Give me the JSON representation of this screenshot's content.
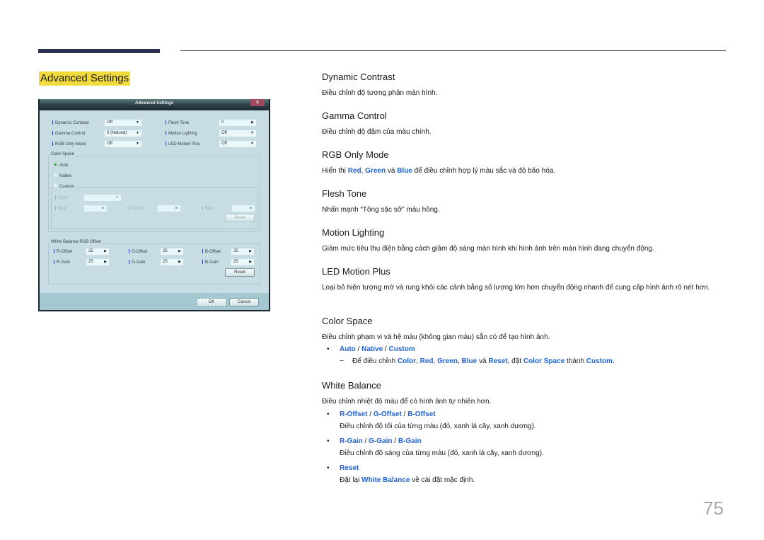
{
  "section_title": "Advanced Settings",
  "page_number": "75",
  "dialog": {
    "title": "Advanced Settings",
    "close_label": "x",
    "rows": [
      {
        "label": "Dynamic Contrast",
        "value": "Off"
      },
      {
        "label": "Gamma Control",
        "value": "0 (Natural)"
      },
      {
        "label": "RGB Only Mode",
        "value": "Off"
      }
    ],
    "rows_right": [
      {
        "label": "Flesh Tone",
        "value": "0"
      },
      {
        "label": "Motion Lighting",
        "value": "Off"
      },
      {
        "label": "LED Motion Plus",
        "value": "Off"
      }
    ],
    "color_space": {
      "legend": "Color Space",
      "options": [
        "Auto",
        "Native",
        "Custom"
      ],
      "selected": "Auto",
      "color_label": "Color",
      "color_value": "",
      "red_label": "Red",
      "green_label": "Green",
      "blue_label": "Blue",
      "reset_label": "Reset"
    },
    "white_balance": {
      "legend": "White Balance RGB Offset",
      "r_offset_label": "R-Offset",
      "r_offset_value": "25",
      "g_offset_label": "G-Offset",
      "g_offset_value": "25",
      "b_offset_label": "B-Offset",
      "b_offset_value": "25",
      "r_gain_label": "R-Gain",
      "r_gain_value": "25",
      "g_gain_label": "G-Gain",
      "g_gain_value": "25",
      "b_gain_label": "B-Gain",
      "b_gain_value": "25",
      "reset_label": "Reset"
    },
    "ok_label": "OK",
    "cancel_label": "Cancel"
  },
  "doc": {
    "dynamic_contrast": {
      "heading": "Dynamic Contrast",
      "text": "Điều chỉnh độ tương phản màn hình."
    },
    "gamma_control": {
      "heading": "Gamma Control",
      "text": "Điều chỉnh độ đậm của màu chính."
    },
    "rgb_only_mode": {
      "heading": "RGB Only Mode",
      "t1": "Hiển thị ",
      "red": "Red",
      "t2": ", ",
      "green": "Green",
      "t3": " và ",
      "blue": "Blue",
      "t4": " để điều chỉnh hợp lý màu sắc và độ bão hòa."
    },
    "flesh_tone": {
      "heading": "Flesh Tone",
      "text": "Nhấn mạnh “Tông sặc sỡ” màu hồng."
    },
    "motion_lighting": {
      "heading": "Motion Lighting",
      "text": "Giảm mức tiêu thụ điện bằng cách giảm độ sáng màn hình khi hình ảnh trên màn hình đang chuyển động."
    },
    "led_motion_plus": {
      "heading": "LED Motion Plus",
      "text": "Loại bỏ hiện tượng mờ và rung khỏi các cảnh bằng số lượng lớn hơn chuyển động nhanh để cung cấp hình ảnh rõ nét hơn."
    },
    "color_space": {
      "heading": "Color Space",
      "text": "Điều chỉnh phạm vi và hệ màu (không gian màu) sẵn có để tạo hình ảnh.",
      "bullet": "•",
      "auto": "Auto",
      "sep": " / ",
      "native": "Native",
      "custom": "Custom",
      "dash": "−",
      "s1": "Để điều chỉnh ",
      "color": "Color",
      "c1": ", ",
      "red": "Red",
      "c2": ", ",
      "green": "Green",
      "c3": ", ",
      "blue": "Blue",
      "s2": " và ",
      "reset": "Reset",
      "s3": ", đặt ",
      "color_space": "Color Space",
      "s4": " thành ",
      "custom2": "Custom",
      "s5": "."
    },
    "white_balance": {
      "heading": "White Balance",
      "text": "Điều chỉnh nhiệt độ màu để có hình ảnh tự nhiên hơn.",
      "bullet": "•",
      "r_offset": "R-Offset",
      "g_offset": "G-Offset",
      "b_offset": "B-Offset",
      "sep": " / ",
      "offset_text": "Điều chỉnh độ tối của từng màu (đỏ, xanh lá cây, xanh dương).",
      "r_gain": "R-Gain",
      "g_gain": "G-Gain",
      "b_gain": "B-Gain",
      "gain_text": "Điều chỉnh độ sáng của từng màu (đỏ, xanh lá cây, xanh dương).",
      "reset": "Reset",
      "reset_t1": "Đặt lại ",
      "reset_wb": "White Balance",
      "reset_t2": " về cài đặt mặc định."
    }
  },
  "colors": {
    "accent_blue": "#1e63d6",
    "highlight_yellow": "#f0da3c",
    "header_bar": "#2b3250"
  }
}
